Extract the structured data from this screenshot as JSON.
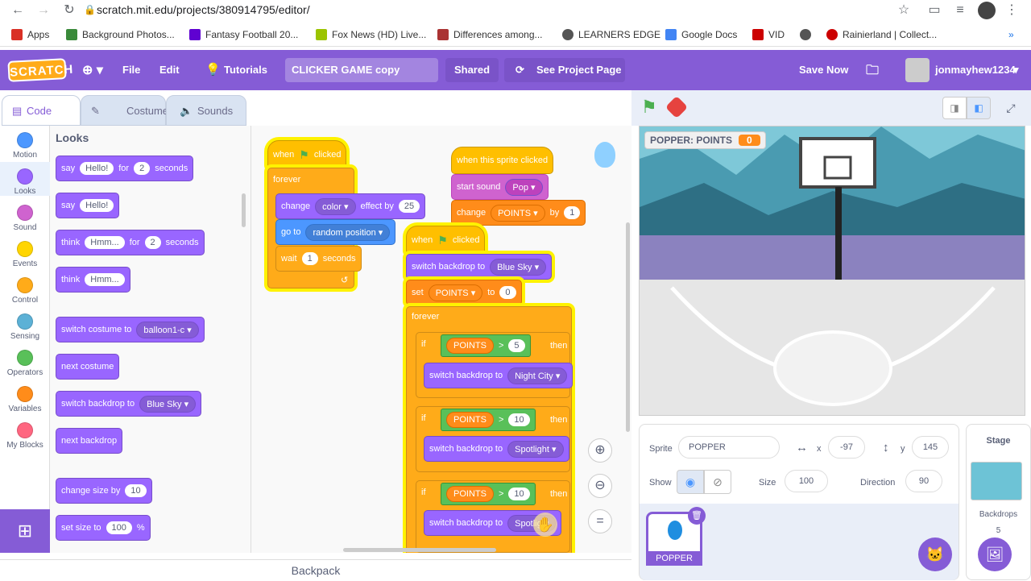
{
  "browser": {
    "url": "scratch.mit.edu/projects/380914795/editor/",
    "bookmarks": [
      "Apps",
      "Background Photos...",
      "Fantasy Football 20...",
      "Fox News (HD) Live...",
      "Differences among...",
      "LEARNERS EDGE",
      "Google Docs",
      "VID",
      "",
      "Rainierland | Collect..."
    ]
  },
  "menu": {
    "logo": "SCRATCH",
    "file": "File",
    "edit": "Edit",
    "tutorials": "Tutorials",
    "project_title": "CLICKER GAME copy",
    "shared": "Shared",
    "see_project": "See Project Page",
    "save_now": "Save Now",
    "username": "jonmayhew1234"
  },
  "tabs": {
    "code": "Code",
    "costumes": "Costumes",
    "sounds": "Sounds"
  },
  "categories": [
    {
      "label": "Motion",
      "color": "#4c97ff"
    },
    {
      "label": "Looks",
      "color": "#9966ff"
    },
    {
      "label": "Sound",
      "color": "#cf63cf"
    },
    {
      "label": "Events",
      "color": "#ffd500"
    },
    {
      "label": "Control",
      "color": "#ffab19"
    },
    {
      "label": "Sensing",
      "color": "#5cb1d6"
    },
    {
      "label": "Operators",
      "color": "#59c059"
    },
    {
      "label": "Variables",
      "color": "#ff8c1a"
    },
    {
      "label": "My Blocks",
      "color": "#ff6680"
    }
  ],
  "palette": {
    "heading": "Looks",
    "say_for": {
      "a": "say",
      "msg": "Hello!",
      "b": "for",
      "n": "2",
      "c": "seconds"
    },
    "say": {
      "a": "say",
      "msg": "Hello!"
    },
    "think_for": {
      "a": "think",
      "msg": "Hmm...",
      "b": "for",
      "n": "2",
      "c": "seconds"
    },
    "think": {
      "a": "think",
      "msg": "Hmm..."
    },
    "switch_costume": {
      "a": "switch costume to",
      "v": "balloon1-c"
    },
    "next_costume": "next costume",
    "switch_backdrop": {
      "a": "switch backdrop to",
      "v": "Blue Sky"
    },
    "next_backdrop": "next backdrop",
    "change_size": {
      "a": "change size by",
      "n": "10"
    },
    "set_size": {
      "a": "set size to",
      "n": "100",
      "c": "%"
    }
  },
  "script1": {
    "hat": "when",
    "hat2": "clicked",
    "forever": "forever",
    "change_effect": {
      "a": "change",
      "v": "color",
      "b": "effect by",
      "n": "25"
    },
    "goto": {
      "a": "go to",
      "v": "random position"
    },
    "wait": {
      "a": "wait",
      "n": "1",
      "c": "seconds"
    }
  },
  "script2": {
    "hat": "when this sprite clicked",
    "sound": {
      "a": "start sound",
      "v": "Pop"
    },
    "change": {
      "a": "change",
      "v": "POINTS",
      "b": "by",
      "n": "1"
    }
  },
  "script3": {
    "hat": "when",
    "hat2": "clicked",
    "switch": {
      "a": "switch backdrop to",
      "v": "Blue Sky"
    },
    "set": {
      "a": "set",
      "v": "POINTS",
      "b": "to",
      "n": "0"
    },
    "forever": "forever",
    "ifs": [
      {
        "if": "if",
        "var": "POINTS",
        "op": ">",
        "n": "5",
        "then": "then",
        "a": "switch backdrop to",
        "v": "Night City"
      },
      {
        "if": "if",
        "var": "POINTS",
        "op": ">",
        "n": "10",
        "then": "then",
        "a": "switch backdrop to",
        "v": "Spotlight"
      },
      {
        "if": "if",
        "var": "POINTS",
        "op": ">",
        "n": "10",
        "then": "then",
        "a": "switch backdrop to",
        "v": "Spotlig"
      }
    ]
  },
  "stage": {
    "monitor_label": "POPPER: POINTS",
    "monitor_value": "0"
  },
  "sprite_info": {
    "sprite_label": "Sprite",
    "sprite_name": "POPPER",
    "x_label": "x",
    "x": "-97",
    "y_label": "y",
    "y": "145",
    "show_label": "Show",
    "size_label": "Size",
    "size": "100",
    "direction_label": "Direction",
    "direction": "90",
    "thumb_name": "POPPER"
  },
  "stage_panel": {
    "title": "Stage",
    "backdrops_label": "Backdrops",
    "backdrops_count": "5"
  },
  "backpack": "Backpack"
}
